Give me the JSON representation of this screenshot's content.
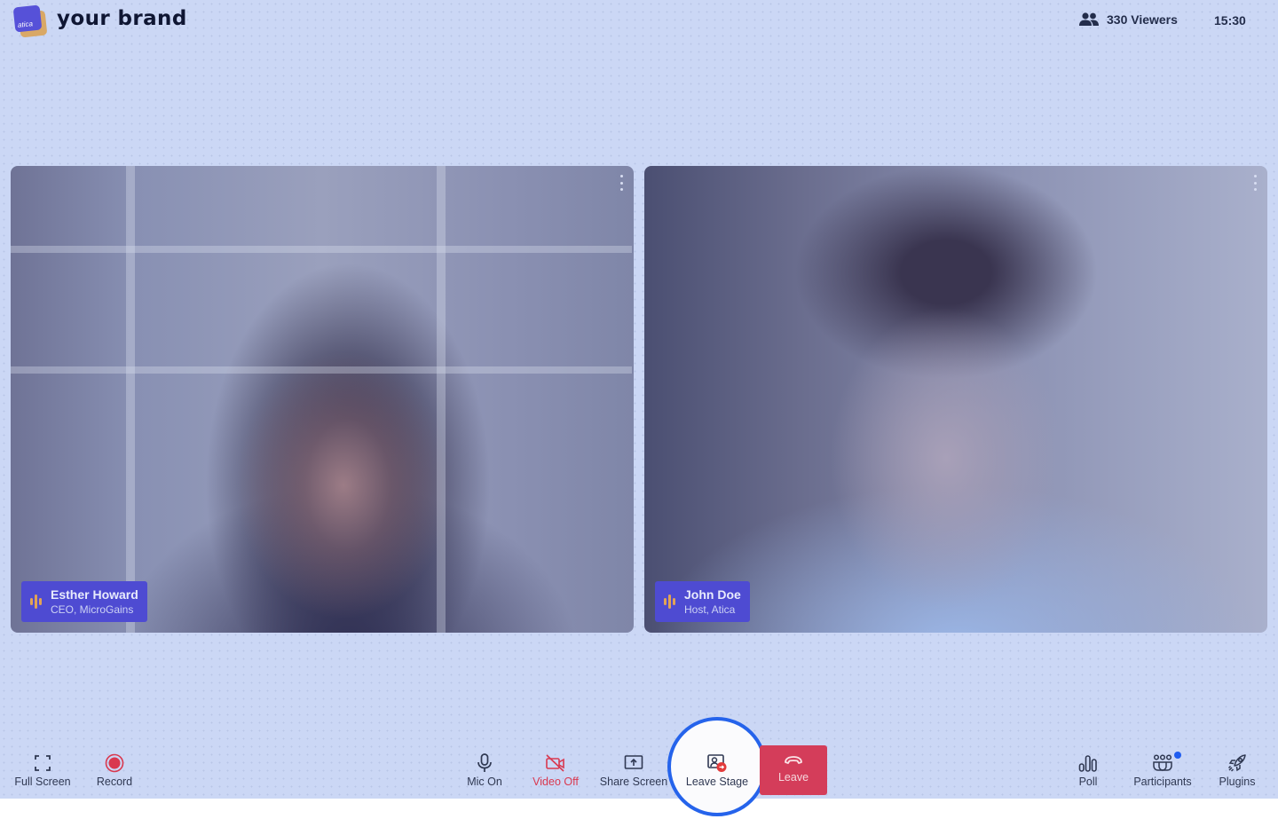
{
  "header": {
    "logo_text": "atica",
    "brand": "your brand",
    "viewers_icon": "people-icon",
    "viewers": "330 Viewers",
    "clock": "15:30"
  },
  "participants": [
    {
      "name": "Esther Howard",
      "role": "CEO, MicroGains",
      "speaking_icon": "audio-wave-icon"
    },
    {
      "name": "John Doe",
      "role": "Host, Atica",
      "speaking_icon": "audio-wave-icon"
    }
  ],
  "controls": {
    "left": [
      {
        "id": "full-screen",
        "label": "Full Screen",
        "icon": "fullscreen-icon"
      },
      {
        "id": "record",
        "label": "Record",
        "icon": "record-icon"
      }
    ],
    "center": [
      {
        "id": "mic",
        "label": "Mic On",
        "icon": "microphone-icon"
      },
      {
        "id": "video",
        "label": "Video Off",
        "icon": "video-off-icon"
      },
      {
        "id": "share-screen",
        "label": "Share Screen",
        "icon": "share-screen-icon"
      },
      {
        "id": "leave-stage",
        "label": "Leave Stage",
        "icon": "leave-stage-icon"
      },
      {
        "id": "leave",
        "label": "Leave",
        "icon": "hang-up-icon"
      }
    ],
    "right": [
      {
        "id": "poll",
        "label": "Poll",
        "icon": "poll-icon"
      },
      {
        "id": "participants",
        "label": "Participants",
        "icon": "participants-icon",
        "has_notification": true
      },
      {
        "id": "plugins",
        "label": "Plugins",
        "icon": "rocket-icon"
      }
    ]
  },
  "colors": {
    "background": "#cbd7f5",
    "accent": "#4e4bd2",
    "danger": "#d43d5a",
    "highlight_ring": "#2563eb",
    "notification_dot": "#1f5cf0"
  }
}
